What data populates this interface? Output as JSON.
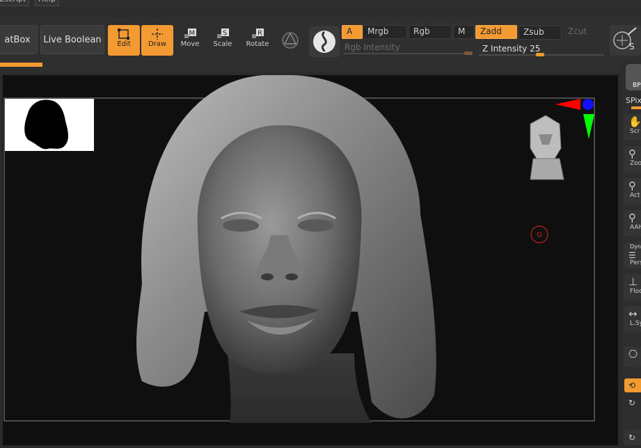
{
  "menu": {
    "items": [
      "Zscript",
      "Help"
    ]
  },
  "toolbar": {
    "gizmo_box_label": "atBox",
    "live_boolean_label": "Live Boolean",
    "tools": [
      {
        "label": "Edit",
        "active": true
      },
      {
        "label": "Draw",
        "active": true
      },
      {
        "label": "Move",
        "active": false
      },
      {
        "label": "Scale",
        "active": false
      },
      {
        "label": "Rotate",
        "active": false
      }
    ],
    "modes": {
      "a": "A",
      "mrgb": "Mrgb",
      "rgb": "Rgb",
      "m": "M",
      "zadd": "Zadd",
      "zsub": "Zsub",
      "zcut": "Zcut"
    },
    "rgb_intensity_label": "Rgb Intensity",
    "z_intensity_label": "Z Intensity",
    "z_intensity_value": "25",
    "right_button_label": "S"
  },
  "rightbar": {
    "top_label": "BP",
    "spix_label": "SPix",
    "items": [
      "Scr",
      "Zoo",
      "Act",
      "AAH",
      "Pers",
      "Floo",
      "L.Sy",
      "",
      ""
    ],
    "dynamic_label": "Dyna"
  },
  "colors": {
    "accent": "#f39a33",
    "viewport_bg": "#101010",
    "axis_red": "#ff0000",
    "axis_green": "#00ff00",
    "axis_blue": "#1010ff"
  }
}
